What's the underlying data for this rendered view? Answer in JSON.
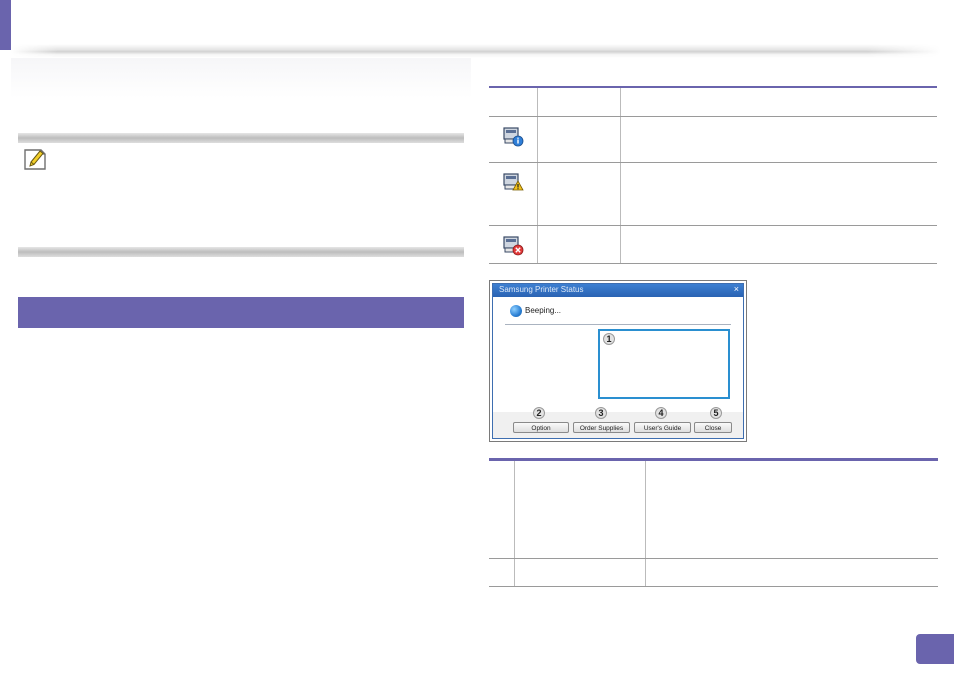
{
  "header": {
    "accent_color": "#6a64ad"
  },
  "note": {
    "icon": "note-pencil-icon"
  },
  "section": {
    "band_color": "#6a64ad"
  },
  "status_table": {
    "rows": [
      {
        "icon": "printer-info-icon"
      },
      {
        "icon": "printer-warning-icon"
      },
      {
        "icon": "printer-error-icon"
      }
    ]
  },
  "dialog": {
    "title": "Samsung Printer Status",
    "close_glyph": "×",
    "status_text": "Beeping...",
    "status_icon": "info-globe-icon",
    "callouts": [
      "1",
      "2",
      "3",
      "4",
      "5"
    ],
    "buttons": {
      "option": "Option",
      "order_supplies": "Order Supplies",
      "users_guide": "User's Guide",
      "close": "Close"
    },
    "panel_border_color": "#2a8fd0"
  },
  "callout_table": {},
  "page": {
    "badge_color": "#6a64ad"
  }
}
